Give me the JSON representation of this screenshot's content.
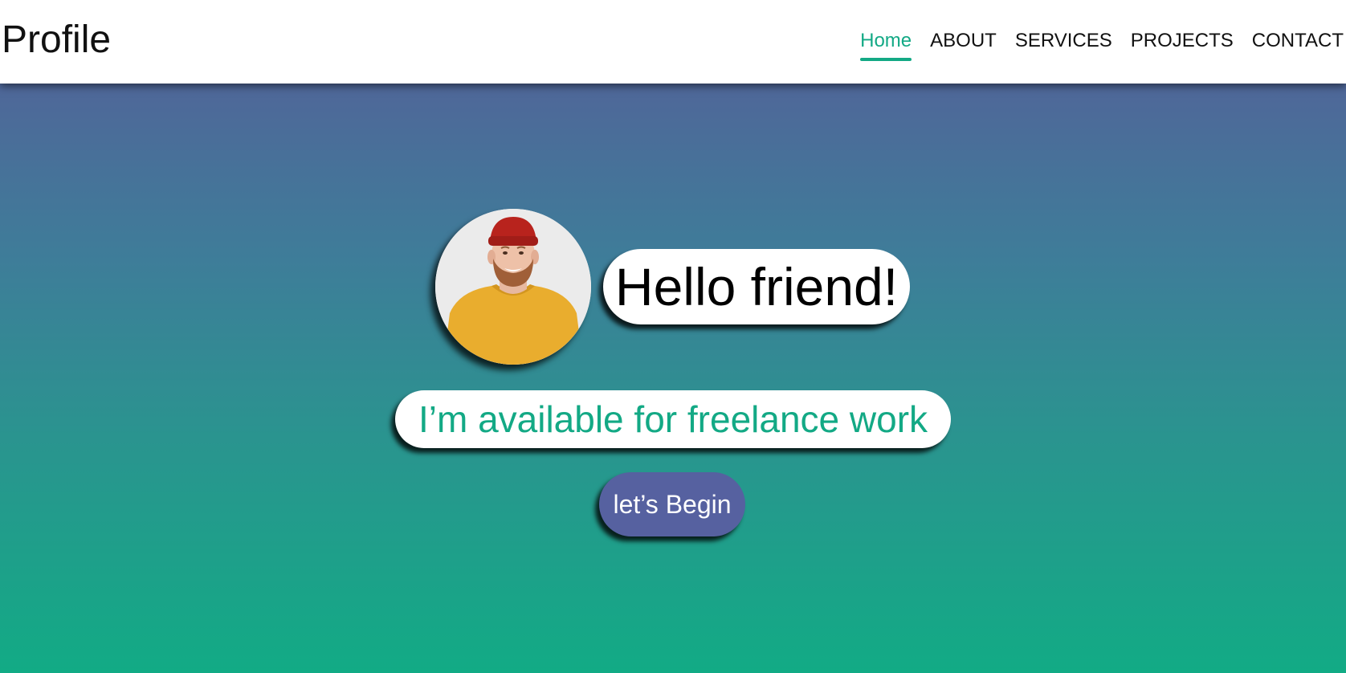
{
  "header": {
    "brand": "Profile",
    "nav": [
      {
        "label": "Home",
        "active": true
      },
      {
        "label": "ABOUT",
        "active": false
      },
      {
        "label": "SERVICES",
        "active": false
      },
      {
        "label": "PROJECTS",
        "active": false
      },
      {
        "label": "CONTACT",
        "active": false
      }
    ]
  },
  "hero": {
    "greeting": "Hello friend!",
    "tagline": "I’m available for freelance work",
    "cta_label": "let’s Begin"
  },
  "colors": {
    "accent": "#13a985",
    "button": "#5661a0",
    "gradient_top": "#4f6799",
    "gradient_bottom": "#12ab85"
  }
}
